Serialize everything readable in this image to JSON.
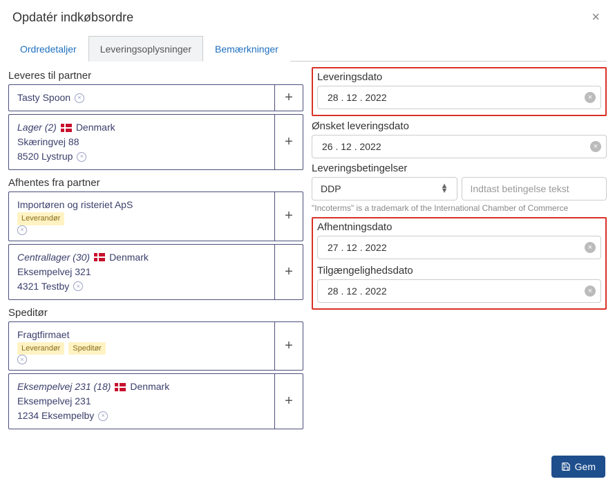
{
  "header": {
    "title": "Opdatér indkøbsordre"
  },
  "tabs": {
    "order_details": "Ordredetaljer",
    "delivery_info": "Leveringsoplysninger",
    "remarks": "Bemærkninger"
  },
  "left": {
    "deliver_to": {
      "label": "Leveres til partner",
      "partner": "Tasty Spoon",
      "address": {
        "name": "Lager (2)",
        "country": "Denmark",
        "street": "Skæringvej 88",
        "city": "8520 Lystrup"
      }
    },
    "pickup_from": {
      "label": "Afhentes fra partner",
      "partner": "Importøren og risteriet ApS",
      "partner_tag": "Leverandør",
      "address": {
        "name": "Centrallager (30)",
        "country": "Denmark",
        "street": "Eksempelvej 321",
        "city": "4321 Testby"
      }
    },
    "forwarder": {
      "label": "Speditør",
      "partner": "Fragtfirmaet",
      "partner_tags": [
        "Leverandør",
        "Speditør"
      ],
      "address": {
        "name": "Eksempelvej 231 (18)",
        "country": "Denmark",
        "street": "Eksempelvej 231",
        "city": "1234 Eksempelby"
      }
    }
  },
  "right": {
    "delivery_date": {
      "label": "Leveringsdato",
      "value": "28 . 12 . 2022"
    },
    "requested_date": {
      "label": "Ønsket leveringsdato",
      "value": "26 . 12 . 2022"
    },
    "conditions": {
      "label": "Leveringsbetingelser",
      "value": "DDP",
      "placeholder": "Indtast betingelse tekst",
      "hint": "\"Incoterms\" is a trademark of the International Chamber of Commerce"
    },
    "pickup_date": {
      "label": "Afhentningsdato",
      "value": "27 . 12 . 2022"
    },
    "availability_date": {
      "label": "Tilgængelighedsdato",
      "value": "28 . 12 . 2022"
    }
  },
  "footer": {
    "save": "Gem"
  }
}
